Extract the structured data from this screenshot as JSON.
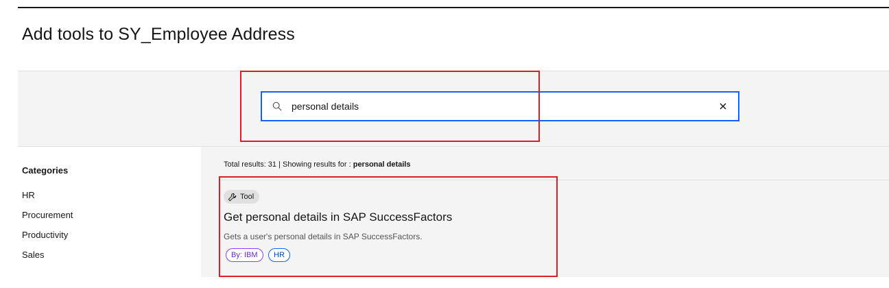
{
  "page": {
    "title": "Add tools to SY_Employee Address"
  },
  "search": {
    "value": "personal details",
    "icon": "search-icon",
    "clear_icon": "close-icon"
  },
  "sidebar": {
    "heading": "Categories",
    "items": [
      {
        "label": "HR"
      },
      {
        "label": "Procurement"
      },
      {
        "label": "Productivity"
      },
      {
        "label": "Sales"
      }
    ]
  },
  "results": {
    "summary_prefix": "Total results: 31 | Showing results for : ",
    "query": "personal details",
    "items": [
      {
        "type_label": "Tool",
        "type_icon": "wrench-icon",
        "title": "Get personal details in SAP SuccessFactors",
        "description": "Gets a user's personal details in SAP SuccessFactors.",
        "tags": [
          "By: IBM",
          "HR"
        ]
      }
    ]
  },
  "colors": {
    "accent": "#0f62fe",
    "highlight": "#da1e28",
    "panel_bg": "#f4f4f4",
    "ibm_tag": "#8a3ffc"
  }
}
